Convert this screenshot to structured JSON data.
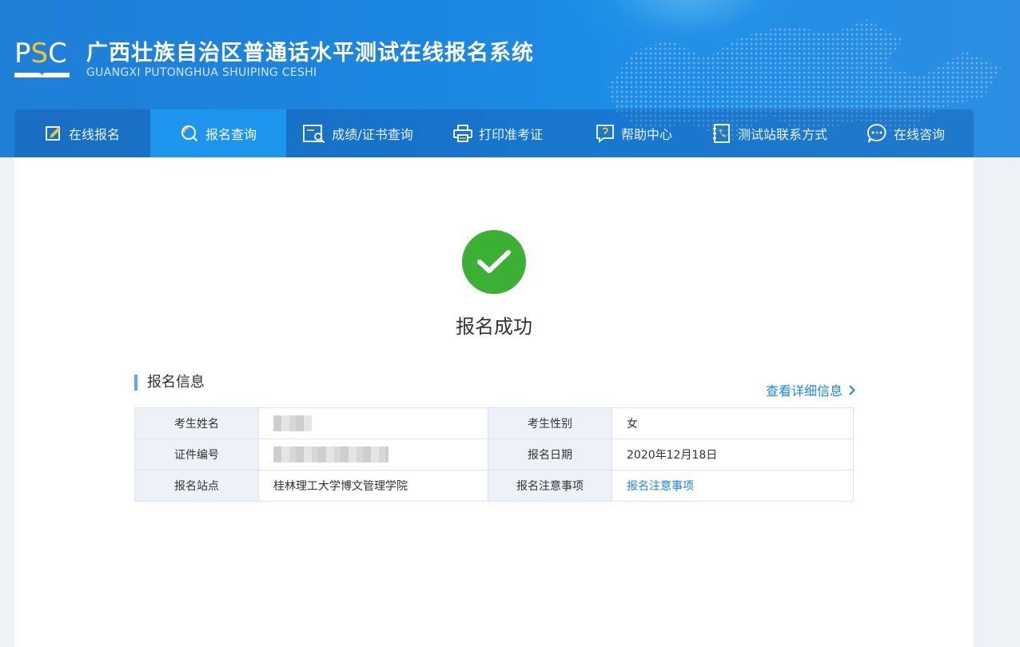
{
  "header": {
    "logo_text_p": "P",
    "logo_text_s": "S",
    "logo_text_c": "C",
    "title_cn": "广西壮族自治区普通话水平测试在线报名系统",
    "title_en": "GUANGXI PUTONGHUA SHUIPING CESHI"
  },
  "nav": {
    "items": [
      {
        "label": "在线报名",
        "icon": "edit-icon"
      },
      {
        "label": "报名查询",
        "icon": "search-icon"
      },
      {
        "label": "成绩/证书查询",
        "icon": "certificate-search-icon"
      },
      {
        "label": "打印准考证",
        "icon": "printer-icon"
      },
      {
        "label": "帮助中心",
        "icon": "help-icon"
      },
      {
        "label": "测试站联系方式",
        "icon": "phone-book-icon"
      },
      {
        "label": "在线咨询",
        "icon": "chat-icon"
      }
    ],
    "active_index": 1
  },
  "main": {
    "success_text": "报名成功",
    "section_title": "报名信息",
    "detail_link": "查看详细信息",
    "rows": [
      {
        "k1": "考生姓名",
        "v1": "",
        "v1_redacted": true,
        "k2": "考生性别",
        "v2": "女"
      },
      {
        "k1": "证件编号",
        "v1": "",
        "v1_redacted": true,
        "k2": "报名日期",
        "v2": "2020年12月18日"
      },
      {
        "k1": "报名站点",
        "v1": "桂林理工大学博文管理学院",
        "k2": "报名注意事项",
        "v2": "报名注意事项",
        "v2_link": true
      }
    ]
  },
  "colors": {
    "header_blue": "#1b86e0",
    "nav_active": "#1e96f0",
    "success_green": "#3cb034",
    "link_blue": "#1e88e5",
    "logo_yellow": "#f3c531"
  }
}
